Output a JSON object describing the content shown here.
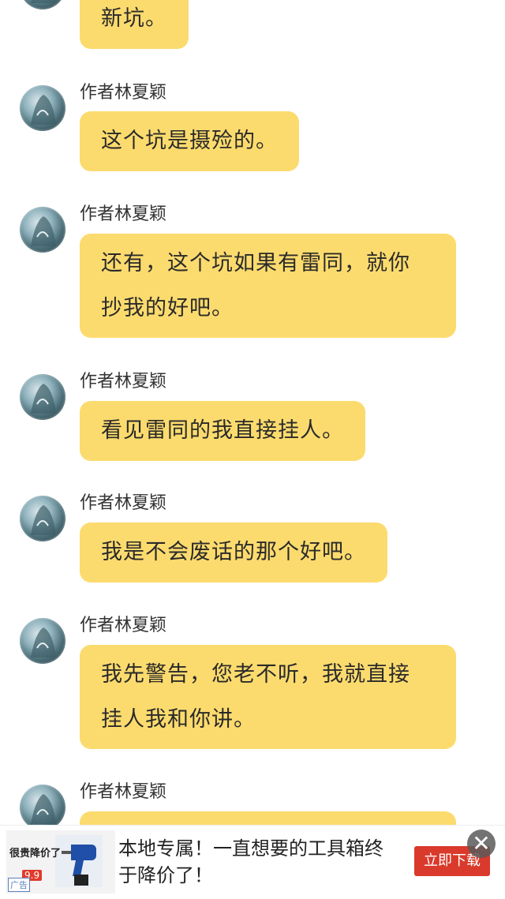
{
  "chat": {
    "messages": [
      {
        "author": "",
        "text_lines": [
          "新坑。"
        ]
      },
      {
        "author": "作者林夏颖",
        "text_lines": [
          "这个坑是摄殓的。"
        ]
      },
      {
        "author": "作者林夏颖",
        "text_lines": [
          "还有，这个坑如果有雷同，就你",
          "抄我的好吧。"
        ]
      },
      {
        "author": "作者林夏颖",
        "text_lines": [
          "看见雷同的我直接挂人。"
        ]
      },
      {
        "author": "作者林夏颖",
        "text_lines": [
          "我是不会废话的那个好吧。"
        ]
      },
      {
        "author": "作者林夏颖",
        "text_lines": [
          "我先警告，您老不听，我就直接",
          "挂人我和你讲。"
        ]
      },
      {
        "author": "作者林夏颖",
        "text_lines": []
      }
    ]
  },
  "ad": {
    "thumb_title": "很贵降价了",
    "thumb_price": "9.9",
    "thumb_label": "广告",
    "text": "本地专属！一直想要的工具箱终于降价了！",
    "button_label": "立即下载",
    "close_icon": "close-icon"
  },
  "colors": {
    "bubble": "#fcdb6e",
    "ad_button": "#d93a2b"
  }
}
